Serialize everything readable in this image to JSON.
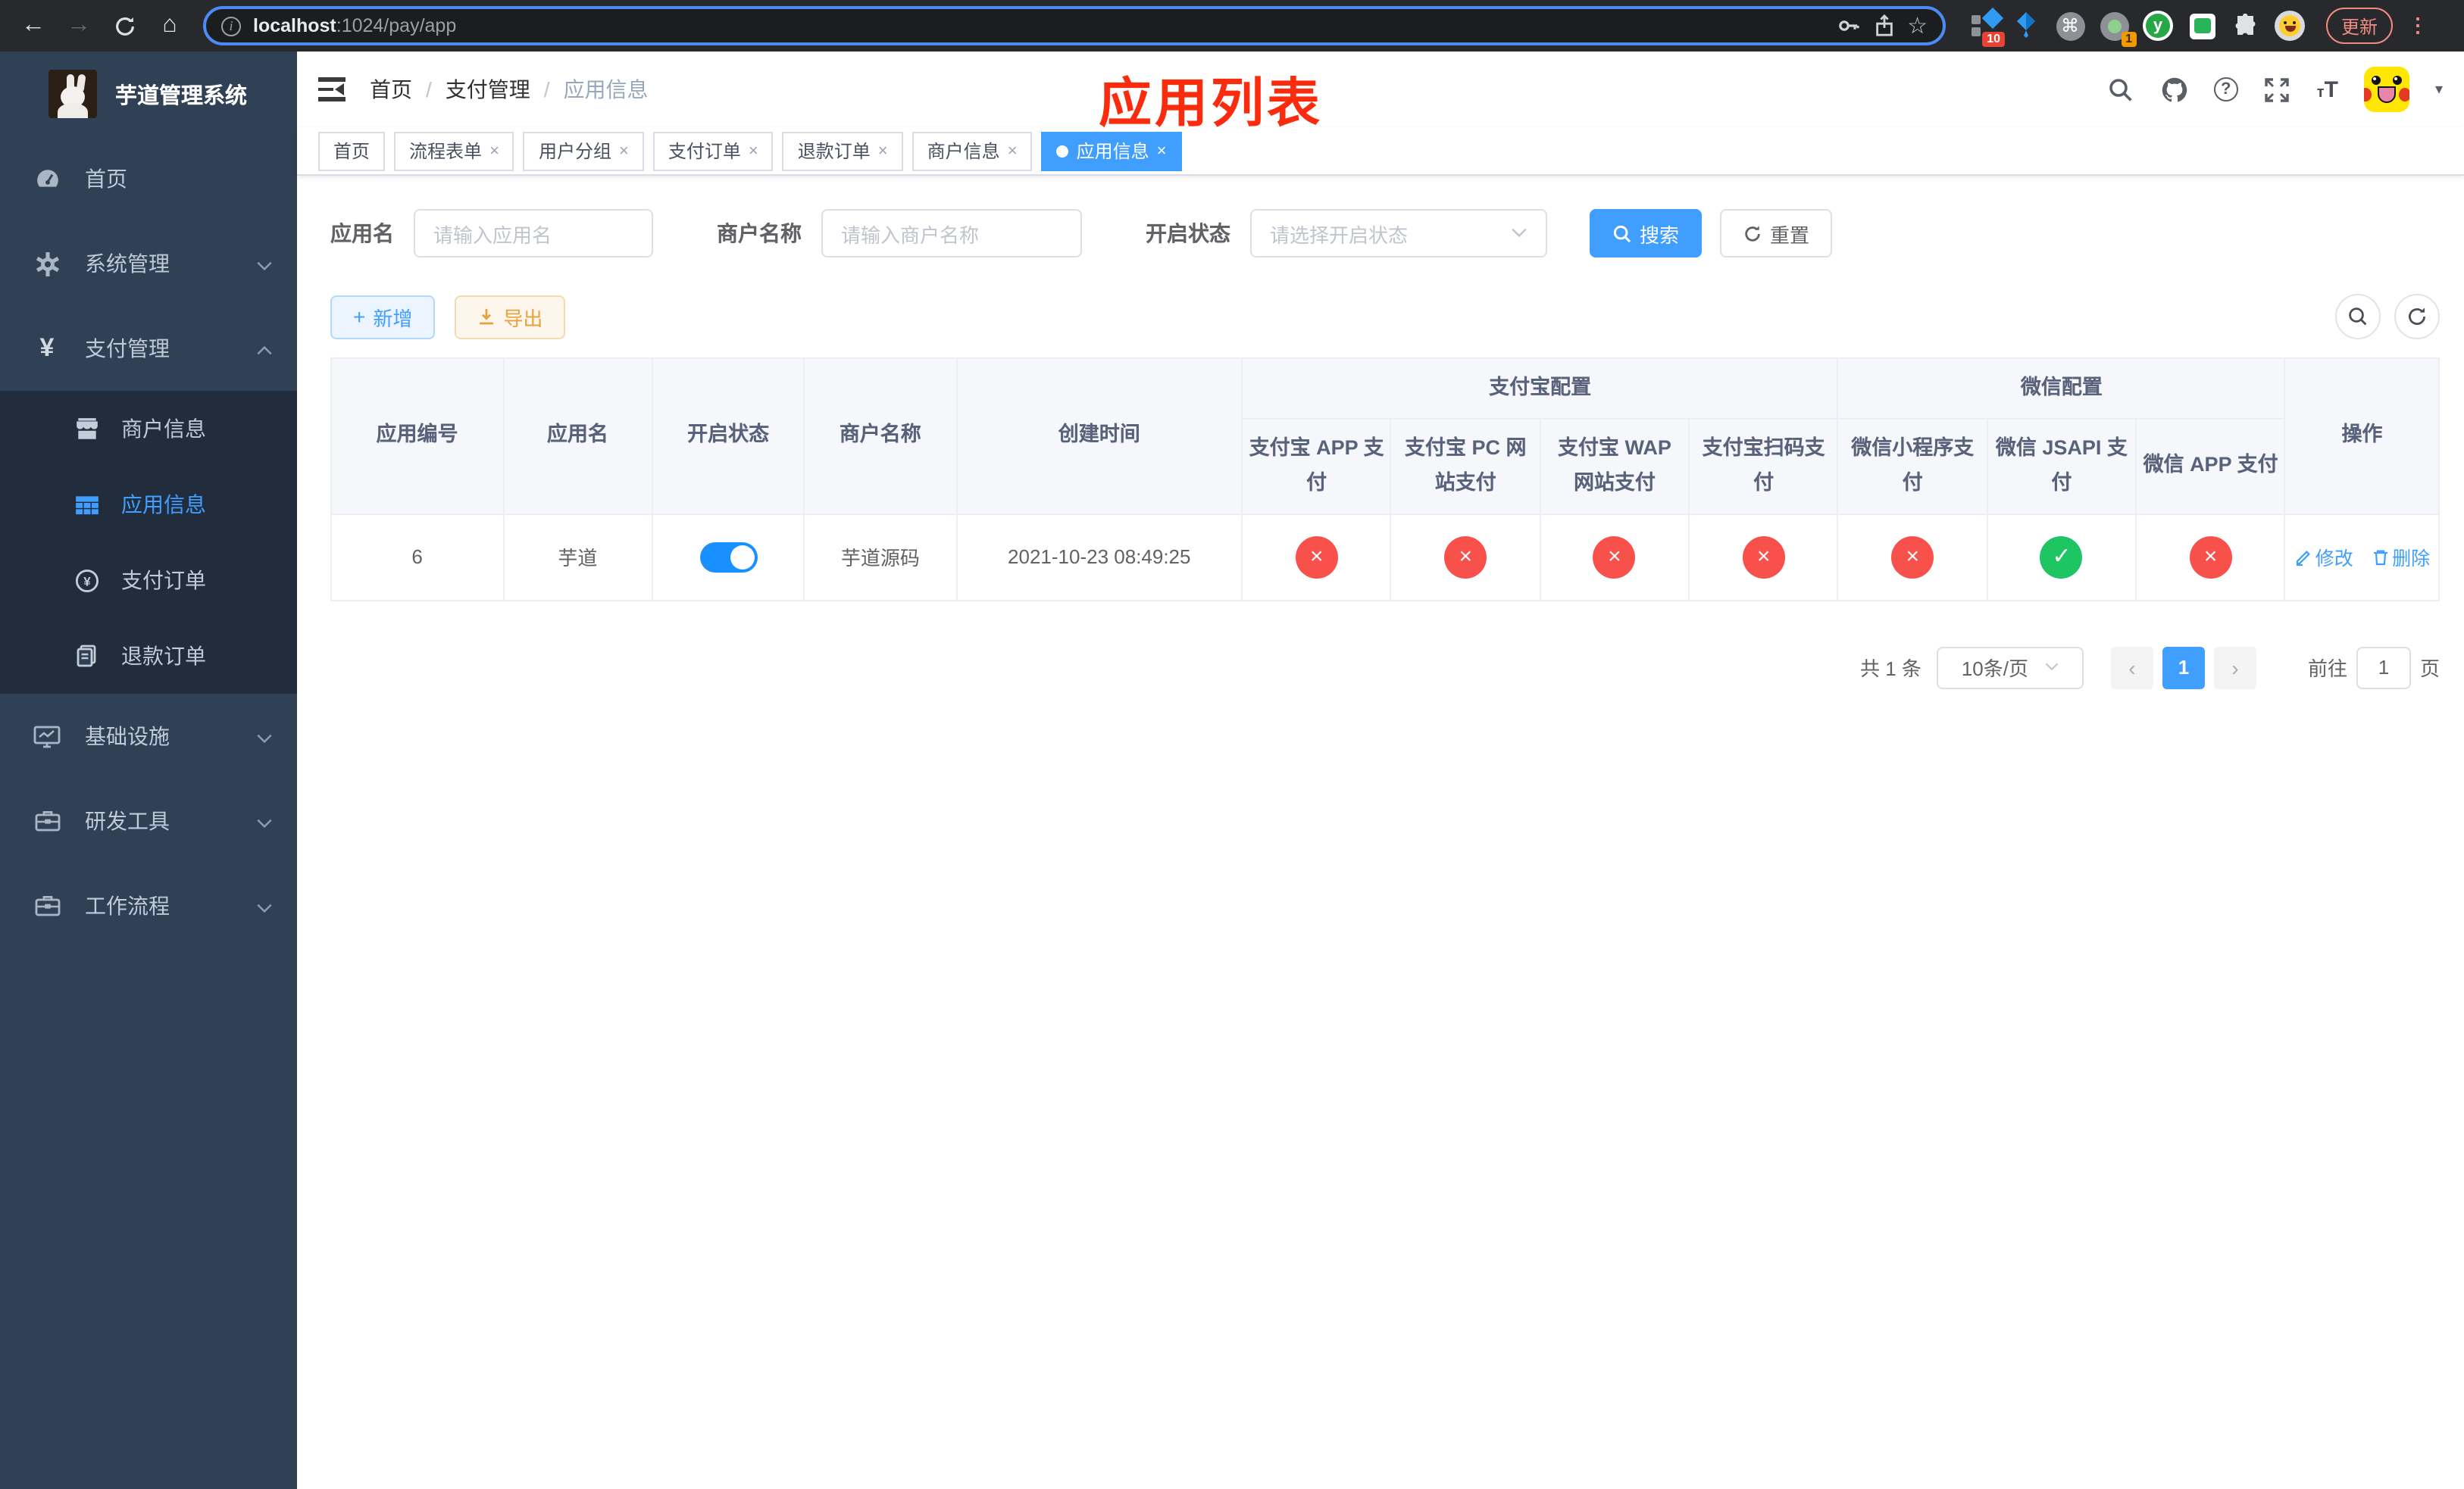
{
  "browser": {
    "url_host": "localhost",
    "url_path": ":1024/pay/app",
    "update_button": "更新",
    "badge_red": "10",
    "badge_orange": "1",
    "ext_letter": "y"
  },
  "sidebar": {
    "title": "芋道管理系统",
    "items_top": [
      {
        "label": "首页",
        "icon": "dashboard-icon"
      },
      {
        "label": "系统管理",
        "icon": "gear-icon"
      },
      {
        "label": "支付管理",
        "icon": "yen-icon"
      }
    ],
    "submenu": [
      {
        "label": "商户信息",
        "icon": "store-icon"
      },
      {
        "label": "应用信息",
        "icon": "grid-icon"
      },
      {
        "label": "支付订单",
        "icon": "yen-circle-icon"
      },
      {
        "label": "退款订单",
        "icon": "document-icon"
      }
    ],
    "items_bottom": [
      {
        "label": "基础设施",
        "icon": "monitor-icon"
      },
      {
        "label": "研发工具",
        "icon": "toolbox-icon"
      },
      {
        "label": "工作流程",
        "icon": "toolbox-icon"
      }
    ]
  },
  "header": {
    "breadcrumb": [
      "首页",
      "支付管理",
      "应用信息"
    ],
    "annotation": "应用列表"
  },
  "tabs": [
    {
      "label": "首页"
    },
    {
      "label": "流程表单"
    },
    {
      "label": "用户分组"
    },
    {
      "label": "支付订单"
    },
    {
      "label": "退款订单"
    },
    {
      "label": "商户信息"
    },
    {
      "label": "应用信息"
    }
  ],
  "filters": {
    "app_name_label": "应用名",
    "app_name_placeholder": "请输入应用名",
    "merchant_label": "商户名称",
    "merchant_placeholder": "请输入商户名称",
    "status_label": "开启状态",
    "status_placeholder": "请选择开启状态",
    "search_label": "搜索",
    "reset_label": "重置"
  },
  "toolbar": {
    "add_label": "新增",
    "export_label": "导出"
  },
  "table": {
    "simple_cols": [
      "应用编号",
      "应用名",
      "开启状态",
      "商户名称",
      "创建时间"
    ],
    "groups": [
      {
        "label": "支付宝配置",
        "children": [
          "支付宝 APP 支付",
          "支付宝 PC 网站支付",
          "支付宝 WAP 网站支付",
          "支付宝扫码支付"
        ]
      },
      {
        "label": "微信配置",
        "children": [
          "微信小程序支付",
          "微信 JSAPI 支付",
          "微信 APP 支付"
        ]
      }
    ],
    "ops_col": "操作",
    "row": {
      "id": "6",
      "name": "芋道",
      "enabled": true,
      "merchant": "芋道源码",
      "created": "2021-10-23 08:49:25",
      "statuses": [
        false,
        false,
        false,
        false,
        false,
        true,
        false
      ],
      "edit_label": "修改",
      "delete_label": "删除"
    }
  },
  "pagination": {
    "total": "共 1 条",
    "page_size": "10条/页",
    "page": "1",
    "goto_label": "前往",
    "goto_value": "1",
    "unit": "页"
  },
  "colors": {
    "primary": "#409eff",
    "danger": "#f8514b",
    "success": "#1ec563",
    "warning": "#e6a23c",
    "sidebar": "#304156"
  }
}
